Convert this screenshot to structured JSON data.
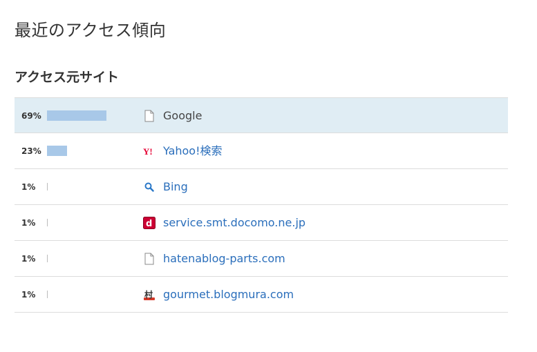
{
  "page_title": "最近のアクセス傾向",
  "section_title": "アクセス元サイト",
  "rows": [
    {
      "percent_label": "69%",
      "percent": 69,
      "site": "Google",
      "icon": "page-icon",
      "highlighted": true,
      "link": false
    },
    {
      "percent_label": "23%",
      "percent": 23,
      "site": "Yahoo!検索",
      "icon": "yahoo-icon",
      "highlighted": false,
      "link": true
    },
    {
      "percent_label": "1%",
      "percent": 1,
      "site": "Bing",
      "icon": "search-icon",
      "highlighted": false,
      "link": true
    },
    {
      "percent_label": "1%",
      "percent": 1,
      "site": "service.smt.docomo.ne.jp",
      "icon": "docomo-icon",
      "highlighted": false,
      "link": true
    },
    {
      "percent_label": "1%",
      "percent": 1,
      "site": "hatenablog-parts.com",
      "icon": "page-icon",
      "highlighted": false,
      "link": true
    },
    {
      "percent_label": "1%",
      "percent": 1,
      "site": "gourmet.blogmura.com",
      "icon": "blogmura-icon",
      "highlighted": false,
      "link": true
    }
  ],
  "colors": {
    "highlight_bg": "#e0edf4",
    "bar": "#a8c8e8",
    "link": "#2a6ebb"
  }
}
